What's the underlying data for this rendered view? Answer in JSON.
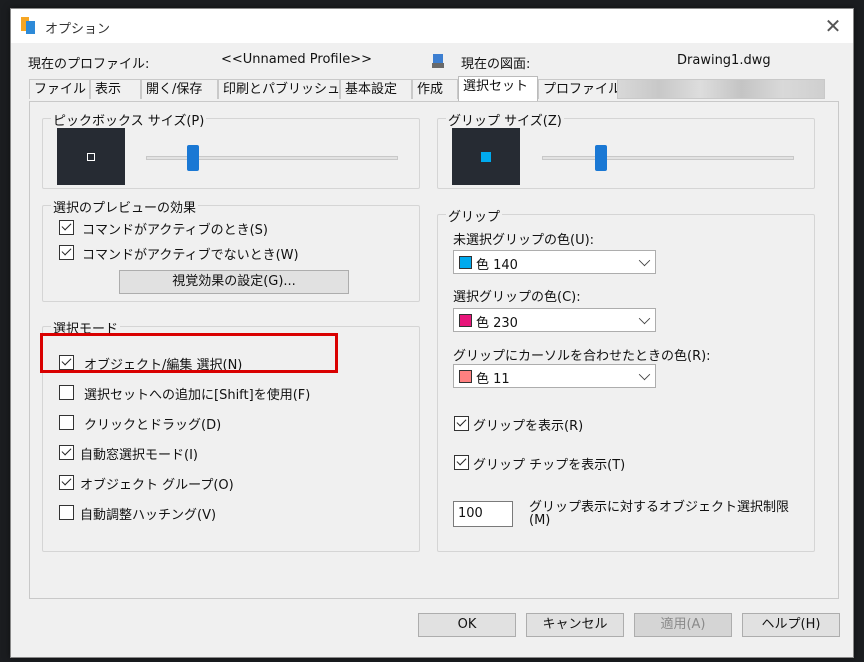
{
  "window": {
    "title": "オプション",
    "close_glyph": "✕"
  },
  "header": {
    "profile_label": "現在のプロファイル:",
    "profile_value": "<<Unnamed Profile>>",
    "drawing_label": "現在の図面:",
    "drawing_value": "Drawing1.dwg"
  },
  "tabs": [
    {
      "label": "ファイル"
    },
    {
      "label": "表示"
    },
    {
      "label": "開く/保存"
    },
    {
      "label": "印刷とパブリッシュ"
    },
    {
      "label": "基本設定"
    },
    {
      "label": "作成"
    },
    {
      "label": "選択セット",
      "active": true
    },
    {
      "label": "プロファイル"
    }
  ],
  "pickbox": {
    "title": "ピックボックス サイズ(P)",
    "slider_value": 0.17
  },
  "grip_size": {
    "title": "グリップ サイズ(Z)",
    "slider_value": 0.22
  },
  "preview_effects": {
    "title": "選択のプレビューの効果",
    "items": [
      {
        "label": "コマンドがアクティブのとき(S)",
        "checked": true
      },
      {
        "label": "コマンドがアクティブでないとき(W)",
        "checked": true
      }
    ],
    "button_label": "視覚効果の設定(G)..."
  },
  "selection_modes": {
    "title": "選択モード",
    "items": [
      {
        "label": "オブジェクト/編集 選択(N)",
        "checked": true
      },
      {
        "label": "選択セットへの追加に[Shift]を使用(F)",
        "checked": false
      },
      {
        "label": "クリックとドラッグ(D)",
        "checked": false
      },
      {
        "label": "自動窓選択モード(I)",
        "checked": true
      },
      {
        "label": "オブジェクト グループ(O)",
        "checked": true
      },
      {
        "label": "自動調整ハッチング(V)",
        "checked": false
      }
    ]
  },
  "grips": {
    "title": "グリップ",
    "unselected_label": "未選択グリップの色(U):",
    "unselected_value": "色 140",
    "unselected_color": "#00aaee",
    "selected_label": "選択グリップの色(C):",
    "selected_value": "色 230",
    "selected_color": "#e8157a",
    "hover_label": "グリップにカーソルを合わせたときの色(R):",
    "hover_value": "色 11",
    "hover_color": "#ff8080",
    "show_grips_label": "グリップを表示(R)",
    "show_grips_checked": true,
    "show_tips_label": "グリップ チップを表示(T)",
    "show_tips_checked": true,
    "limit_value": "100",
    "limit_label_line1": "グリップ表示に対するオブジェクト選択制限",
    "limit_label_line2": "(M)"
  },
  "footer": {
    "ok_label": "OK",
    "cancel_label": "キャンセル",
    "apply_label": "適用(A)",
    "help_label": "ヘルプ(H)"
  },
  "colors": {
    "accent": "#1a78d4",
    "highlight": "#d90000",
    "preview_bg": "#262b33"
  }
}
